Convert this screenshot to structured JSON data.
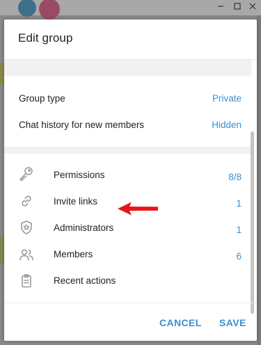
{
  "dialog": {
    "title": "Edit group"
  },
  "settings": [
    {
      "label": "Group type",
      "value": "Private"
    },
    {
      "label": "Chat history for new members",
      "value": "Hidden"
    }
  ],
  "menu": [
    {
      "label": "Permissions",
      "value": "8/8",
      "icon": "key-icon"
    },
    {
      "label": "Invite links",
      "value": "1",
      "icon": "link-icon"
    },
    {
      "label": "Administrators",
      "value": "1",
      "icon": "admin-shield-icon"
    },
    {
      "label": "Members",
      "value": "6",
      "icon": "members-icon"
    },
    {
      "label": "Recent actions",
      "value": "",
      "icon": "clipboard-icon"
    }
  ],
  "footer": {
    "cancel_label": "CANCEL",
    "save_label": "SAVE"
  },
  "colors": {
    "accent": "#3a8fd0",
    "arrow": "#e8141b"
  }
}
